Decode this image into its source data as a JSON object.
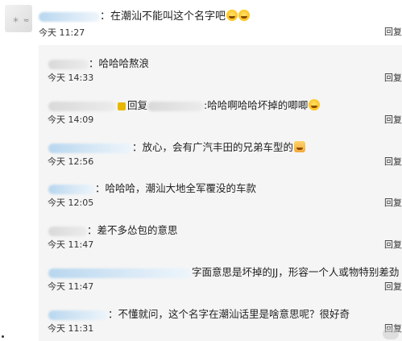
{
  "main": {
    "text": "：在潮汕不能叫这个名字吧",
    "time": "今天 11:27",
    "reply_label": "回复"
  },
  "replies": [
    {
      "text": "：哈哈哈熬浪",
      "time": "今天 14:33",
      "reply_label": "回复"
    },
    {
      "prefix": "回复",
      "text": ":哈哈啊哈哈坏掉的唧唧",
      "time": "今天 14:09",
      "reply_label": "回复"
    },
    {
      "text": "：放心，会有广汽丰田的兄弟车型的",
      "time": "今天 12:56",
      "reply_label": "回复"
    },
    {
      "text": "：哈哈哈，潮汕大地全军覆没的车款",
      "time": "今天 12:05",
      "reply_label": "回复"
    },
    {
      "text": "：差不多怂包的意思",
      "time": "今天 11:47",
      "reply_label": "回复"
    },
    {
      "text": "字面意思是坏掉的JJ，形容一个人或物特别差劲",
      "time": "今天 11:47",
      "reply_label": "回复"
    },
    {
      "text": "：不懂就问，这个名字在潮汕话里是啥意思呢？很好奇",
      "time": "今天 11:31",
      "reply_label": "回复"
    }
  ],
  "icons": {
    "avatar": "avatar",
    "laugh_emoji": "laughing-face-emoji",
    "fox_emoji": "fox-face-emoji"
  }
}
